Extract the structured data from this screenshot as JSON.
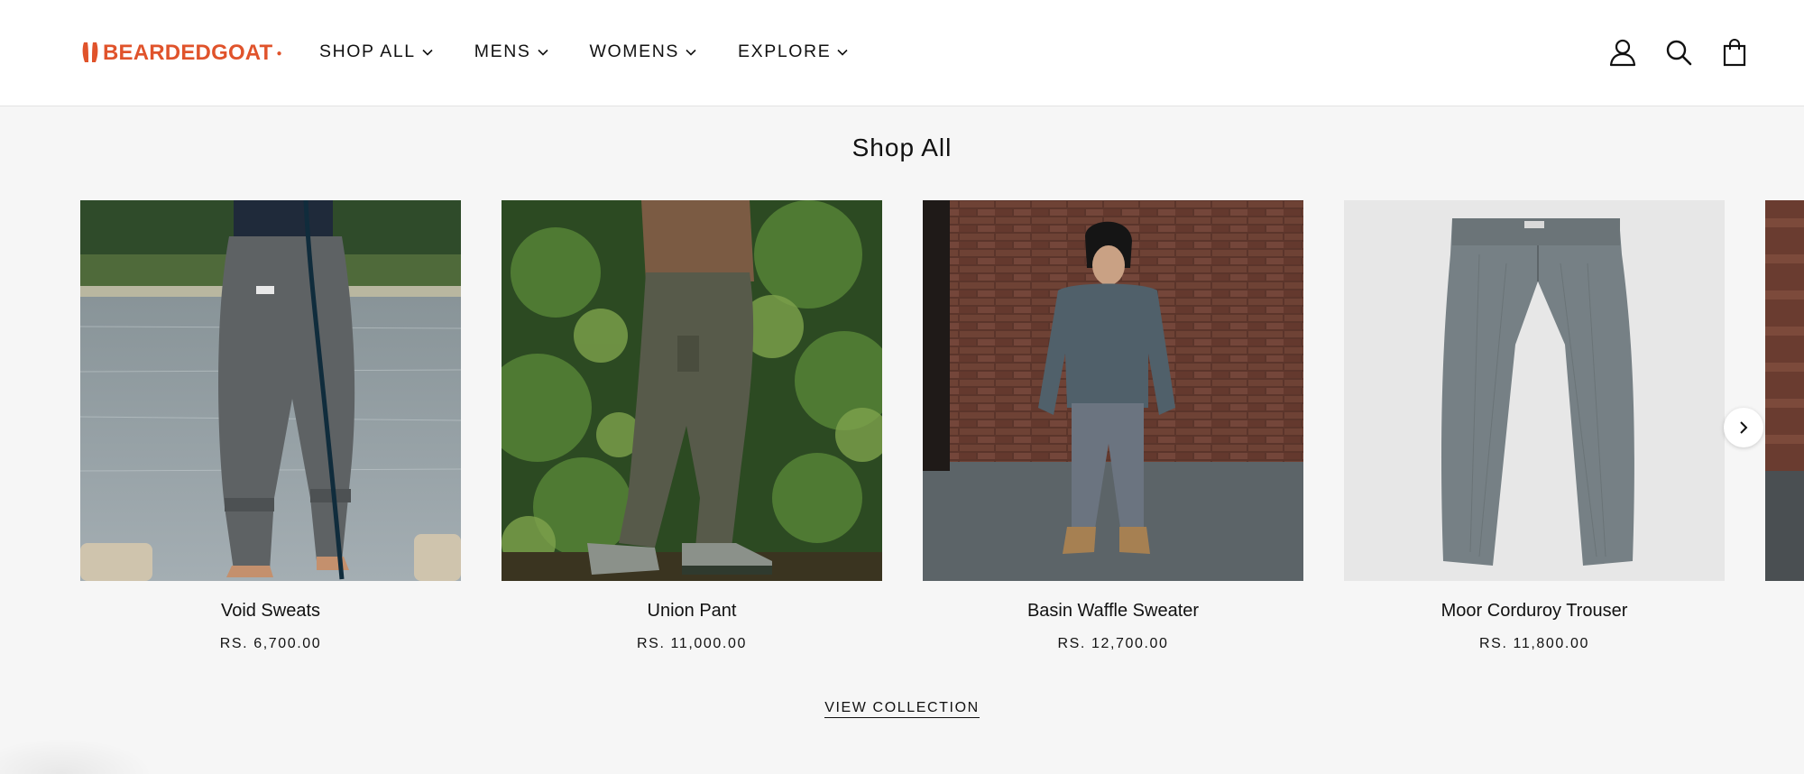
{
  "brand": {
    "logo_text": "BEARDEDGOAT",
    "accent_color": "#e0532b"
  },
  "nav": {
    "items": [
      {
        "label": "SHOP ALL"
      },
      {
        "label": "MENS"
      },
      {
        "label": "WOMENS"
      },
      {
        "label": "EXPLORE"
      }
    ]
  },
  "header_icons": [
    "account-icon",
    "search-icon",
    "cart-icon"
  ],
  "section": {
    "title": "Shop All"
  },
  "products": [
    {
      "name": "Void Sweats",
      "price": "RS. 6,700.00"
    },
    {
      "name": "Union Pant",
      "price": "RS. 11,000.00"
    },
    {
      "name": "Basin Waffle Sweater",
      "price": "RS. 12,700.00"
    },
    {
      "name": "Moor Corduroy Trouser",
      "price": "RS. 11,800.00"
    }
  ],
  "carousel": {
    "next_icon": "chevron-right-icon"
  },
  "footer_link": {
    "label": "VIEW COLLECTION"
  }
}
